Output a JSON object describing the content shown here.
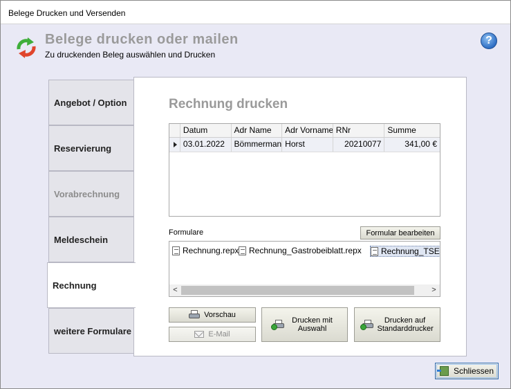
{
  "window": {
    "title": "Belege Drucken und Versenden"
  },
  "header": {
    "title": "Belege drucken oder mailen",
    "subtitle": "Zu druckenden Beleg auswählen und Drucken",
    "help_label": "?"
  },
  "tabs": [
    {
      "label": "Angebot / Option",
      "state": "normal"
    },
    {
      "label": "Reservierung",
      "state": "normal"
    },
    {
      "label": "Vorabrechnung",
      "state": "disabled"
    },
    {
      "label": "Meldeschein",
      "state": "normal"
    },
    {
      "label": "Rechnung",
      "state": "active"
    },
    {
      "label": "weitere Formulare",
      "state": "normal"
    }
  ],
  "panel": {
    "title": "Rechnung drucken",
    "grid": {
      "columns": [
        "Datum",
        "Adr Name",
        "Adr Vorname",
        "RNr",
        "Summe"
      ],
      "rows": [
        [
          "03.01.2022",
          "Bömmermann",
          "Horst",
          "20210077",
          "341,00 €"
        ]
      ]
    },
    "formulare_label": "Formulare",
    "edit_form_button": "Formular bearbeiten",
    "files": [
      "Rechnung.repx",
      "Rechnung_Gastrobeiblatt.repx",
      "Rechnung_TSE.re"
    ],
    "scroll_left": "<",
    "scroll_right": ">",
    "preview_button": "Vorschau",
    "email_button": "E-Mail",
    "print_select_button": "Drucken mit Auswahl",
    "print_default_button": "Drucken auf Standarddrucker"
  },
  "footer": {
    "close_button": "Schliessen"
  }
}
